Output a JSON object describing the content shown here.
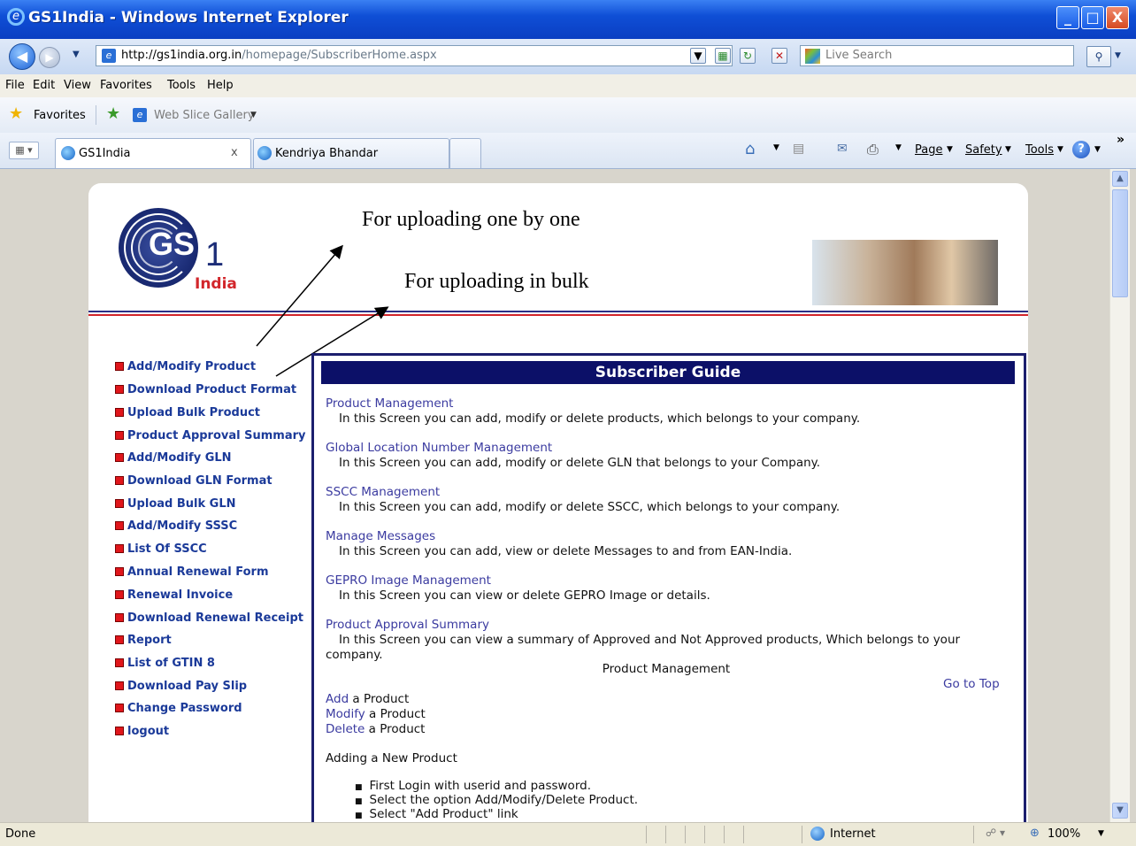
{
  "window": {
    "title": "GS1India - Windows Internet Explorer",
    "min": "_",
    "max": "□",
    "close": "X"
  },
  "address": {
    "url_domain": "http://gs1india.org.in",
    "url_path": "/homepage/SubscriberHome.aspx",
    "search_placeholder": "Live Search"
  },
  "menu": [
    "File",
    "Edit",
    "View",
    "Favorites",
    "Tools",
    "Help"
  ],
  "favorites_bar": {
    "favorites_label": "Favorites",
    "web_slice": "Web Slice Gallery"
  },
  "tabs": [
    {
      "label": "GS1India",
      "close": "x"
    },
    {
      "label": "Kendriya Bhandar"
    }
  ],
  "command_bar": [
    "Page",
    "Safety",
    "Tools"
  ],
  "page": {
    "logo_text": "GS",
    "logo_suffix": "1",
    "logo_country": "India",
    "annotation_one": "For uploading one by one",
    "annotation_bulk": "For uploading in bulk",
    "nav": [
      "Add/Modify Product",
      "Download Product Format",
      "Upload Bulk Product",
      "Product Approval Summary",
      "Add/Modify GLN",
      "Download GLN Format",
      "Upload Bulk GLN",
      "Add/Modify SSSC",
      "List Of SSCC",
      "Annual Renewal Form",
      "Renewal Invoice",
      "Download Renewal Receipt",
      "Report",
      "List of GTIN 8",
      "Download Pay Slip",
      "Change Password",
      "logout"
    ],
    "guide": {
      "heading": "Subscriber Guide",
      "sections": [
        {
          "title": "Product Management",
          "desc": "In this Screen you can add, modify or delete products, which belongs to your company."
        },
        {
          "title": "Global Location Number Management",
          "desc": "In this Screen you can add, modify or delete GLN that belongs to your Company."
        },
        {
          "title": "SSCC Management",
          "desc": "In this Screen you can add, modify or delete SSCC, which belongs to your company."
        },
        {
          "title": "Manage Messages",
          "desc": "In this Screen you can add, view or delete Messages to and from EAN-India."
        },
        {
          "title": "GEPRO Image Management",
          "desc": "In this Screen you can view or delete GEPRO Image or details."
        },
        {
          "title": "Product Approval Summary",
          "desc": "In this Screen you can view a summary of Approved and Not Approved products, Which belongs to your",
          "desc_cont": "company."
        }
      ],
      "sub_heading": "Product Management",
      "go_to_top": "Go to Top",
      "actions": [
        {
          "link": "Add",
          "rest": " a Product"
        },
        {
          "link": "Modify",
          "rest": " a Product"
        },
        {
          "link": "Delete",
          "rest": " a Product"
        }
      ],
      "adding_heading": "Adding a New Product",
      "steps": [
        "First Login with userid and password.",
        "Select the option Add/Modify/Delete Product.",
        "Select \"Add Product\" link"
      ]
    }
  },
  "status": {
    "left": "Done",
    "zone": "Internet",
    "zoom": "100%"
  }
}
